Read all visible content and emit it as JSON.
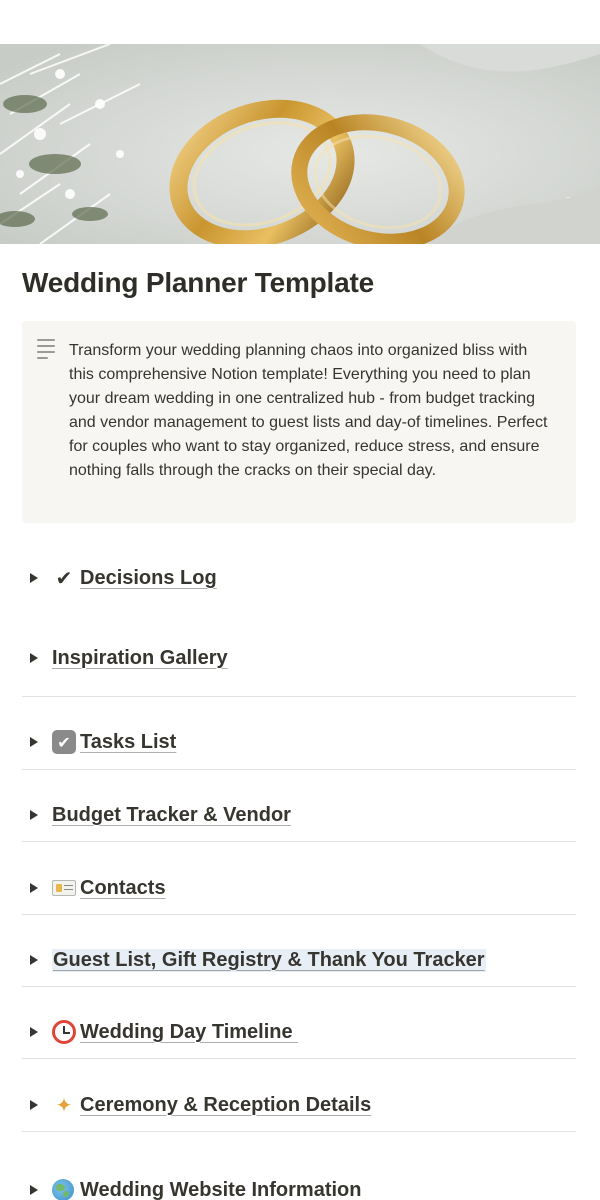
{
  "page": {
    "title": "Wedding Planner Template",
    "cover_alt": "Two gold wedding rings on a light fabric with dried white flowers"
  },
  "callout": {
    "icon": "text-lines-icon",
    "text": "Transform your wedding planning chaos into organized bliss with this comprehensive Notion template! Everything you need to plan your dream wedding in one centralized hub - from budget tracking and vendor management to guest lists and day-of timelines. Perfect for couples who want to stay organized, reduce stress, and ensure nothing falls through the cracks on their special day."
  },
  "toggles": [
    {
      "emoji": "heavy-check-mark",
      "label": "Decisions Log"
    },
    {
      "emoji": "",
      "label": "Inspiration Gallery"
    },
    {
      "emoji": "ballot-box-with-check",
      "label": "Tasks List"
    },
    {
      "emoji": "",
      "label": "Budget Tracker & Vendor"
    },
    {
      "emoji": "identification-card",
      "label": "Contacts"
    },
    {
      "emoji": "",
      "label": "Guest List, Gift Registry & Thank You Tracker"
    },
    {
      "emoji": "alarm-clock",
      "label": "Wedding Day Timeline "
    },
    {
      "emoji": "party-popper",
      "label": "Ceremony & Reception Details"
    },
    {
      "emoji": "globe",
      "label": "Wedding Website Information"
    }
  ],
  "colors": {
    "text": "#37352f",
    "callout_bg": "#f7f6f3",
    "divider": "#e3e2e0",
    "highlight": "#e7eef5"
  }
}
